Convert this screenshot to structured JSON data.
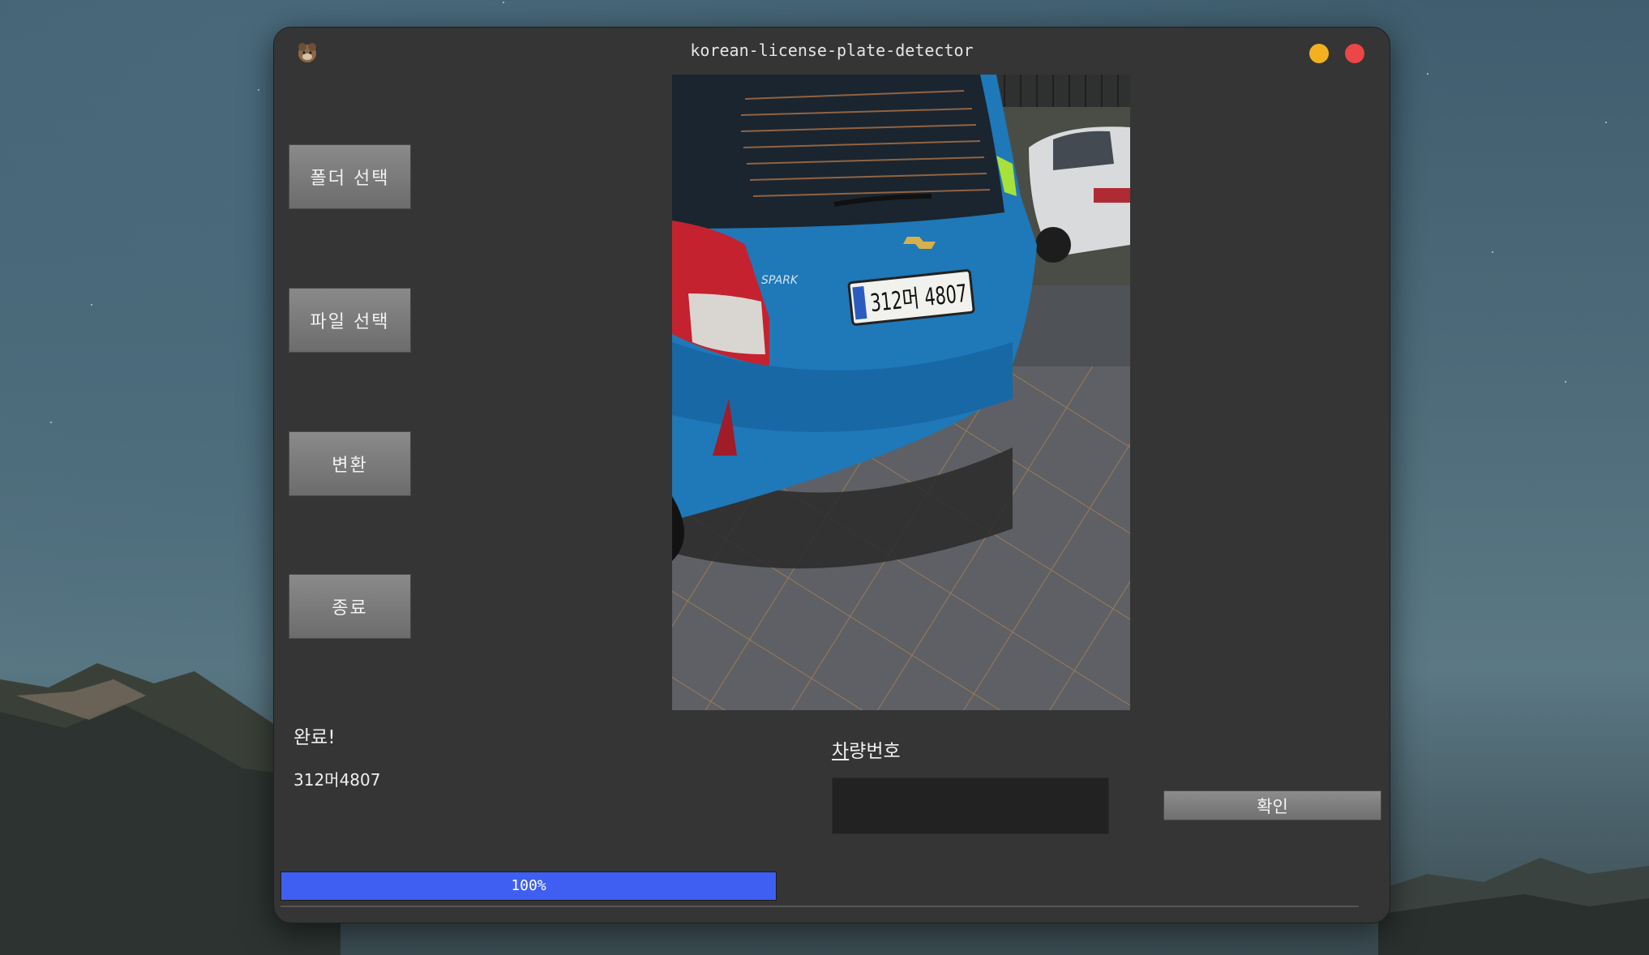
{
  "window": {
    "title": "korean-license-plate-detector"
  },
  "sidebar": {
    "buttons": [
      {
        "label": "폴더 선택"
      },
      {
        "label": "파일 선택"
      },
      {
        "label": "변환"
      },
      {
        "label": "종료"
      }
    ]
  },
  "status": {
    "message": "완료!",
    "result": "312머4807"
  },
  "plate": {
    "label_mnemonic": "차",
    "label_rest": "량번호",
    "value": ""
  },
  "confirm": {
    "label": "확인"
  },
  "progress": {
    "value": 100,
    "text": "100%"
  },
  "photo": {
    "plate_text": "312머 4807",
    "badge_text": "SPARK"
  },
  "colors": {
    "accent": "#3e5ff2",
    "window_bg": "#353535",
    "minimize": "#f3b01f",
    "close": "#ec4646"
  }
}
